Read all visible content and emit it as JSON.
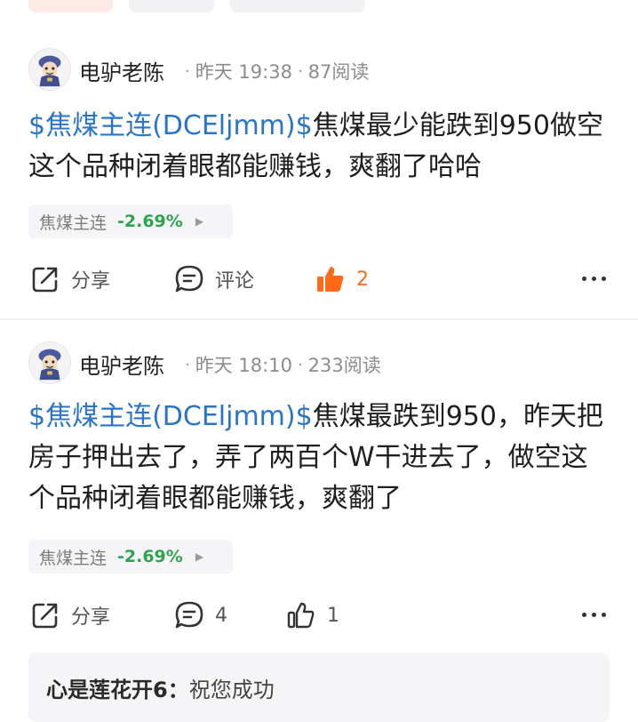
{
  "posts": [
    {
      "author": "电驴老陈",
      "time": "昨天 19:38",
      "reads": "87阅读",
      "tag": "$焦煤主连(DCEljmm)$",
      "text": "焦煤最少能跌到950做空这个品种闭着眼都能赚钱，爽翻了哈哈",
      "stock": {
        "name": "焦煤主连",
        "pct": "-2.69%"
      },
      "share_label": "分享",
      "comment_label": "评论",
      "like_count": "2",
      "liked": true
    },
    {
      "author": "电驴老陈",
      "time": "昨天 18:10",
      "reads": "233阅读",
      "tag": "$焦煤主连(DCEljmm)$",
      "text": "焦煤最跌到950，昨天把房子押出去了，弄了两百个W干进去了，做空这个品种闭着眼都能赚钱，爽翻了",
      "stock": {
        "name": "焦煤主连",
        "pct": "-2.69%"
      },
      "share_label": "分享",
      "comment_label": "4",
      "like_count": "1",
      "liked": false,
      "top_comment": {
        "user": "心是莲花开6：",
        "text": "祝您成功"
      }
    }
  ],
  "colors": {
    "tag": "#2a74c9",
    "liked": "#ff6a1a",
    "down": "#2ea44f"
  }
}
